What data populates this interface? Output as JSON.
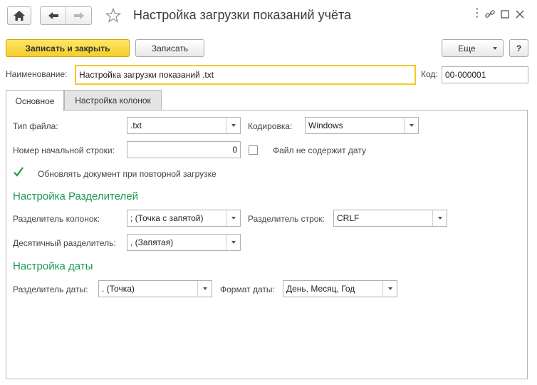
{
  "window": {
    "title": "Настройка загрузки показаний учёта"
  },
  "toolbar": {
    "save_close_label": "Записать и закрыть",
    "save_label": "Записать",
    "more_label": "Еще",
    "help_label": "?"
  },
  "header": {
    "name_label": "Наименование:",
    "name_value": "Настройка загрузки показаний .txt",
    "code_label": "Код:",
    "code_value": "00-000001"
  },
  "tabs": [
    {
      "label": "Основное",
      "active": true
    },
    {
      "label": "Настройка колонок",
      "active": false
    }
  ],
  "main": {
    "file_type_label": "Тип файла:",
    "file_type_value": ".txt",
    "encoding_label": "Кодировка:",
    "encoding_value": "Windows",
    "start_row_label": "Номер начальной строки:",
    "start_row_value": "0",
    "no_date_label": "Файл не содержит дату",
    "no_date_checked": false,
    "update_doc_label": "Обновлять документ при повторной загрузке",
    "update_doc_checked": true
  },
  "separators": {
    "title": "Настройка Разделителей",
    "column_sep_label": "Разделитель колонок:",
    "column_sep_value": "; (Точка с запятой)",
    "row_sep_label": "Разделитель строк:",
    "row_sep_value": "CRLF",
    "decimal_sep_label": "Десятичный разделитель:",
    "decimal_sep_value": ", (Запятая)"
  },
  "date_settings": {
    "title": "Настройка даты",
    "date_sep_label": "Разделитель даты:",
    "date_sep_value": ". (Точка)",
    "date_format_label": "Формат даты:",
    "date_format_value": "День, Месяц, Год"
  },
  "colors": {
    "accent": "#f6cf2a",
    "section": "#1a9a50",
    "check": "#2a9a3a"
  },
  "icons": [
    "home-icon",
    "back-arrow-icon",
    "forward-arrow-icon",
    "star-icon",
    "more-icon",
    "link-icon",
    "maximize-icon",
    "close-icon"
  ]
}
